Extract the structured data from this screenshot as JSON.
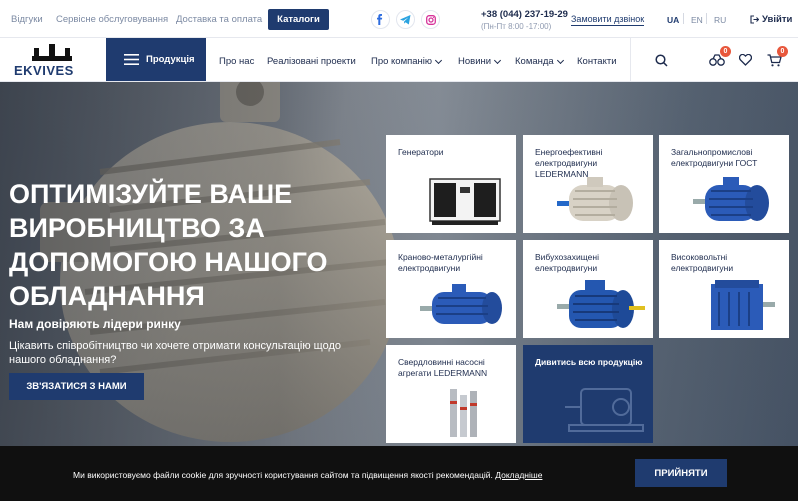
{
  "topbar": {
    "links": [
      "Відгуки",
      "Сервісне обслуговування",
      "Доставка та оплата"
    ],
    "catalogs_label": "Каталоги",
    "social": [
      "facebook-icon",
      "telegram-icon",
      "instagram-icon"
    ],
    "phone": "+38 (044) 237-19-29",
    "hours": "(Пн-Пт 8:00 -17:00)",
    "callback_label": "Замовити дзвінок",
    "languages": [
      "UA",
      "EN",
      "RU"
    ],
    "active_language": "UA",
    "login_label": "Увійти"
  },
  "nav": {
    "logo_text": "EKVIVES",
    "products_label": "Продукція",
    "items": [
      {
        "label": "Про нас",
        "dropdown": false
      },
      {
        "label": "Реалізовані проекти",
        "dropdown": false
      },
      {
        "label": "Про компанію",
        "dropdown": true
      },
      {
        "label": "Новини",
        "dropdown": true
      },
      {
        "label": "Команда",
        "dropdown": true
      },
      {
        "label": "Контакти",
        "dropdown": false
      }
    ],
    "compare_count": "0",
    "cart_count": "0"
  },
  "hero": {
    "title": "ОПТИМІЗУЙТЕ ВАШЕ ВИРОБНИЦТВО ЗА ДОПОМОГОЮ НАШОГО ОБЛАДНАННЯ",
    "subtitle": "Нам довіряють лідери ринку",
    "text": "Цікавить співробітництво чи хочете отримати консультацію щодо нашого обладнання?",
    "button_label": "ЗВ'ЯЗАТИСЯ З НАМИ"
  },
  "products": [
    {
      "title": "Генератори",
      "icon": "generator"
    },
    {
      "title": "Енергоефективні електродвигуни LEDERMANN",
      "icon": "motor-white"
    },
    {
      "title": "Загальнопромислові електродвигуни ГОСТ",
      "icon": "motor-blue"
    },
    {
      "title": "Кранoво-металургійні електродвигуни",
      "icon": "motor-blue-long"
    },
    {
      "title": "Вибухозахищені електродвигуни",
      "icon": "motor-explosion"
    },
    {
      "title": "Високовольтні електродвигуни",
      "icon": "motor-highvolt"
    },
    {
      "title": "Свердловинні насосні агрегати LEDERMANN",
      "icon": "pump"
    },
    {
      "title": "Дивитись всю продукцію",
      "icon": "catalog-outline"
    }
  ],
  "cookie": {
    "text": "Ми використовуємо файли cookie для зручності користування сайтом та підвищення якості рекомендацій.",
    "link_label": "Докладніше",
    "accept_label": "ПРИЙНЯТИ"
  },
  "colors": {
    "brand": "#1f3b6f",
    "badge": "#e8573c",
    "cookie_bg": "#101010"
  }
}
